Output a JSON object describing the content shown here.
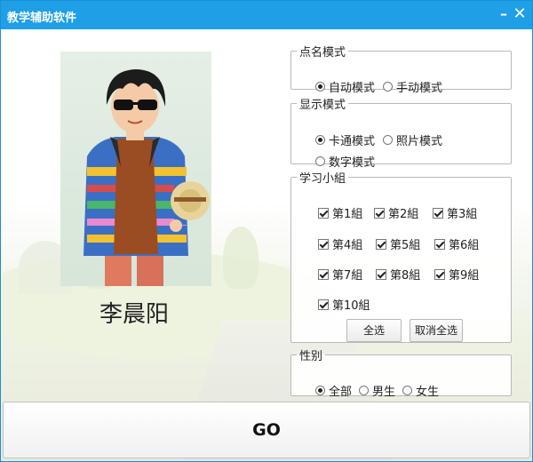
{
  "window": {
    "title": "教学辅助软件",
    "minimize_glyph": "–",
    "close_glyph": "✕"
  },
  "student": {
    "name": "李晨阳",
    "photo": "cartoon-student-portrait"
  },
  "call_mode": {
    "legend": "点名模式",
    "options": [
      {
        "label": "自动模式",
        "selected": true
      },
      {
        "label": "手动模式",
        "selected": false
      }
    ]
  },
  "display_mode": {
    "legend": "显示模式",
    "options": [
      {
        "label": "卡通模式",
        "selected": true
      },
      {
        "label": "照片模式",
        "selected": false
      },
      {
        "label": "数字模式",
        "selected": false
      }
    ]
  },
  "study_groups": {
    "legend": "学习小組",
    "groups": [
      {
        "label": "第1組",
        "checked": true
      },
      {
        "label": "第2組",
        "checked": true
      },
      {
        "label": "第3組",
        "checked": true
      },
      {
        "label": "第4組",
        "checked": true
      },
      {
        "label": "第5組",
        "checked": true
      },
      {
        "label": "第6組",
        "checked": true
      },
      {
        "label": "第7組",
        "checked": true
      },
      {
        "label": "第8組",
        "checked": true
      },
      {
        "label": "第9組",
        "checked": true
      },
      {
        "label": "第10組",
        "checked": true
      }
    ],
    "select_all_label": "全选",
    "deselect_all_label": "取消全选"
  },
  "gender": {
    "legend": "性别",
    "options": [
      {
        "label": "全部",
        "selected": true
      },
      {
        "label": "男生",
        "selected": false
      },
      {
        "label": "女生",
        "selected": false
      }
    ]
  },
  "go_label": "GO",
  "colors": {
    "titlebar": "#1e9fe6"
  }
}
